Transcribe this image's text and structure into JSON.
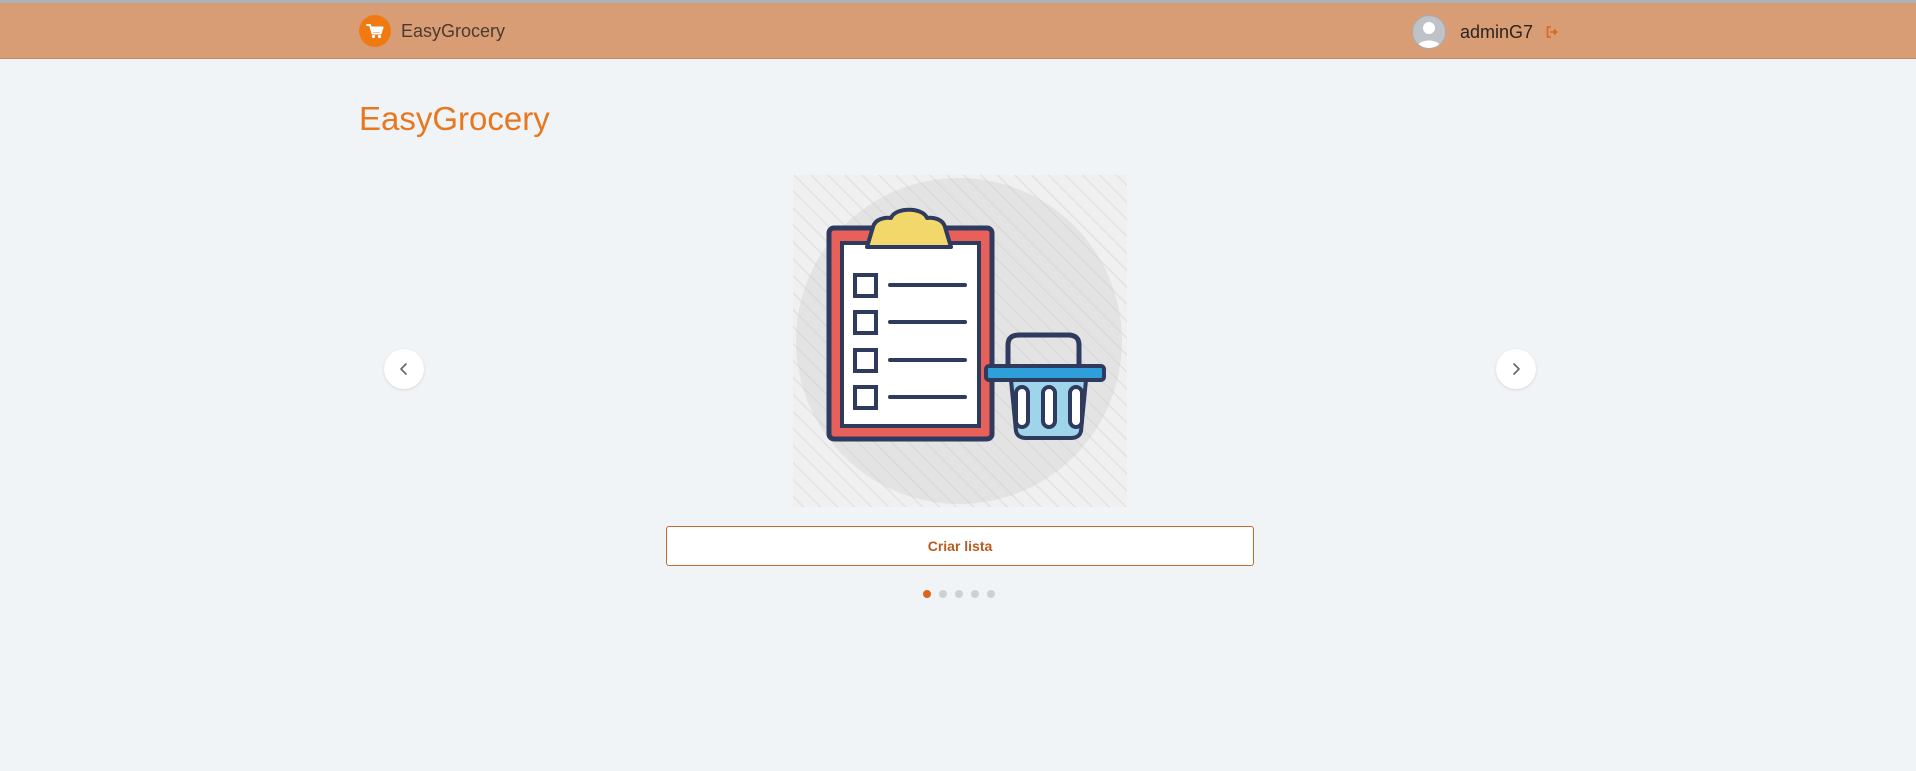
{
  "header": {
    "brand_name": "EasyGrocery",
    "username": "adminG7",
    "icons": {
      "logo": "shopping-cart-icon",
      "avatar": "user-avatar",
      "logout": "logout-icon"
    }
  },
  "main": {
    "title": "EasyGrocery",
    "carousel": {
      "slide_icon": "clipboard-checklist-basket-illustration",
      "prev_icon": "chevron-left-icon",
      "next_icon": "chevron-right-icon",
      "button_label": "Criar lista",
      "total_slides": 5,
      "active_slide": 1
    }
  },
  "colors": {
    "navbar": "#d99d76",
    "accent": "#e8781f",
    "background": "#f1f4f7",
    "dot_active": "#d9661c",
    "dot_inactive": "#cdd1d6"
  }
}
